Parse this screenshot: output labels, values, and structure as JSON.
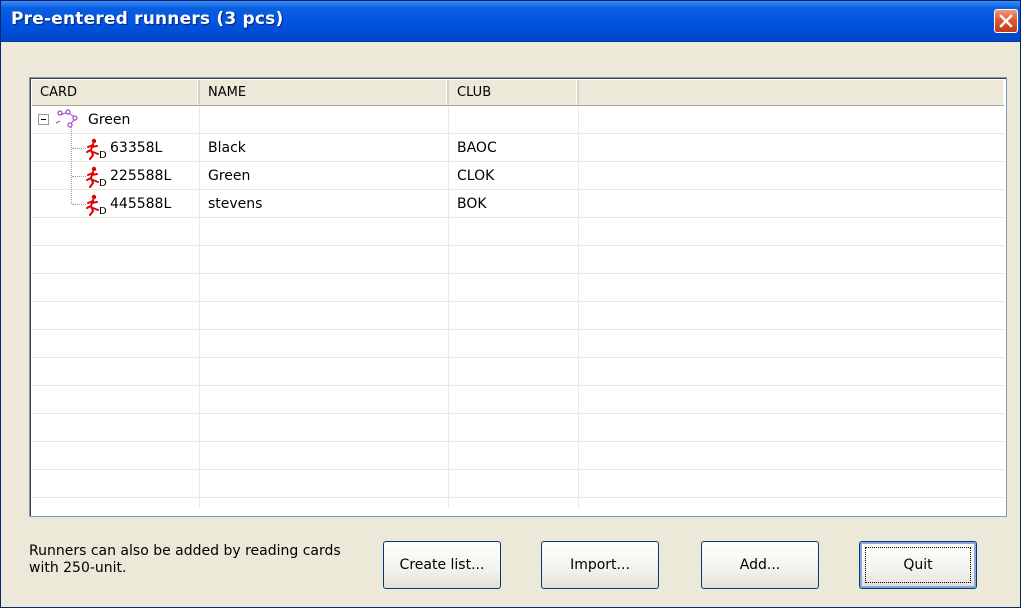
{
  "window": {
    "title": "Pre-entered runners (3 pcs)"
  },
  "listview": {
    "columns": [
      "CARD",
      "NAME",
      "CLUB",
      ""
    ],
    "group": {
      "label": "Green",
      "icon": "course-icon"
    },
    "rows": [
      {
        "card": "63358L",
        "name": "Black",
        "club": "BAOC"
      },
      {
        "card": "225588L",
        "name": "Green",
        "club": "CLOK"
      },
      {
        "card": "445588L",
        "name": "stevens",
        "club": "BOK"
      }
    ]
  },
  "footer": {
    "hint": "Runners can also be added by reading cards with 250-unit.",
    "buttons": {
      "create_list": "Create list...",
      "import": "Import...",
      "add": "Add...",
      "quit": "Quit"
    }
  },
  "colors": {
    "title_bar": "#0054e3",
    "close_button": "#e2582f",
    "course_icon": "#b23fd1",
    "runner_icon": "#e00000"
  }
}
